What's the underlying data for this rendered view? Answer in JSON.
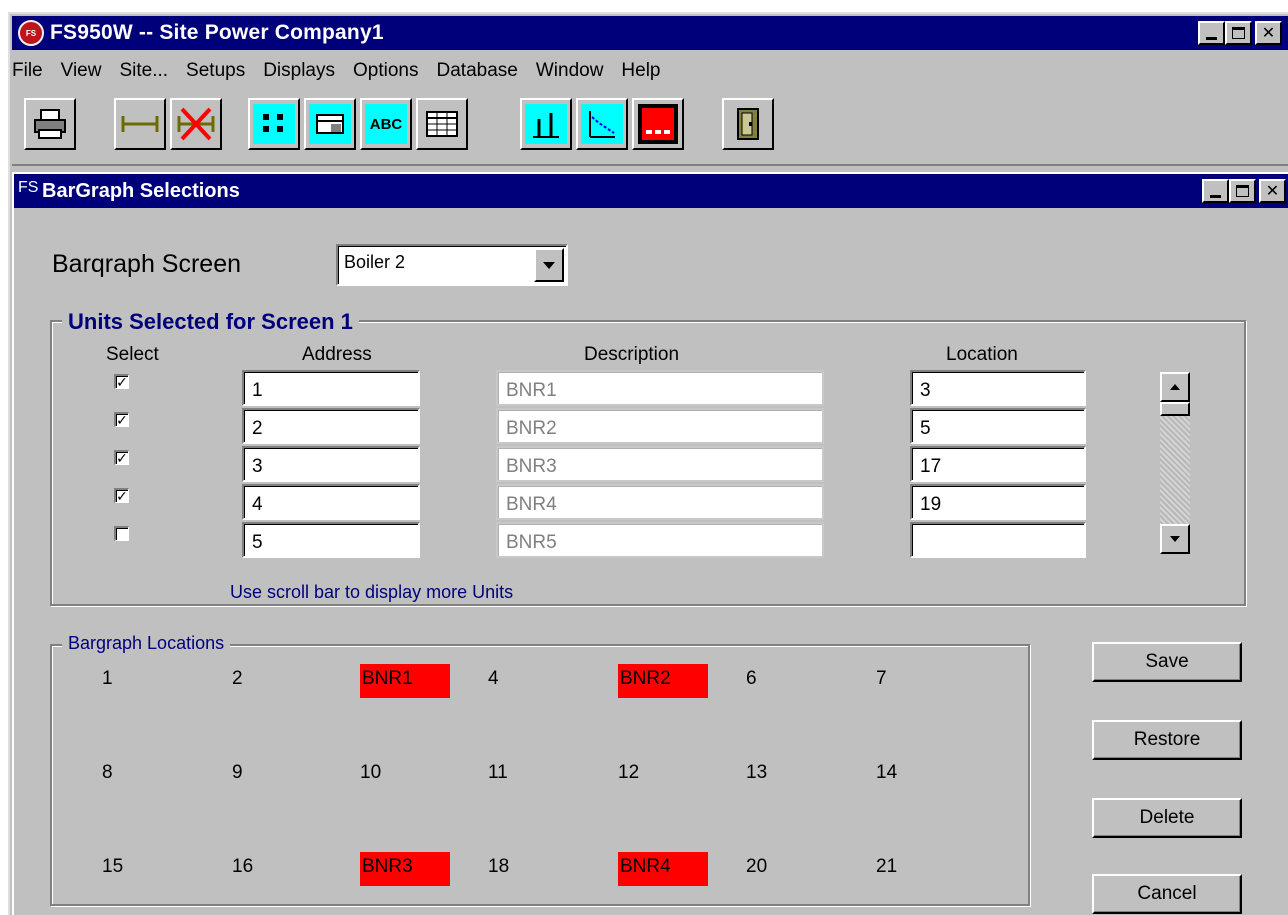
{
  "app": {
    "title": "FS950W -- Site Power Company1",
    "icon_name": "site-power-logo-icon"
  },
  "menu": [
    "File",
    "View",
    "Site...",
    "Setups",
    "Displays",
    "Options",
    "Database",
    "Window",
    "Help"
  ],
  "toolbar": {
    "buttons": [
      {
        "icon": "printer-icon"
      },
      {
        "icon": "range-connect-icon"
      },
      {
        "icon": "range-delete-icon"
      },
      {
        "icon": "list-view-icon"
      },
      {
        "icon": "detail-view-icon"
      },
      {
        "icon": "text-abc-icon",
        "text": "ABC"
      },
      {
        "icon": "table-view-icon"
      },
      {
        "icon": "bargraph-icon"
      },
      {
        "icon": "trend-chart-icon"
      },
      {
        "icon": "alarm-panel-icon"
      },
      {
        "icon": "door-exit-icon"
      }
    ]
  },
  "child_window": {
    "title": "BarGraph Selections",
    "bargraph_screen_label": "Barqraph Screen",
    "bargraph_screen_value": "Boiler 2",
    "units_group_title": "Units Selected for Screen 1",
    "columns": {
      "select": "Select",
      "address": "Address",
      "description": "Description",
      "location": "Location"
    },
    "units": [
      {
        "checked": true,
        "address": "1",
        "description": "BNR1",
        "location": "3"
      },
      {
        "checked": true,
        "address": "2",
        "description": "BNR2",
        "location": "5"
      },
      {
        "checked": true,
        "address": "3",
        "description": "BNR3",
        "location": "17"
      },
      {
        "checked": true,
        "address": "4",
        "description": "BNR4",
        "location": "19"
      },
      {
        "checked": false,
        "address": "5",
        "description": "BNR5",
        "location": ""
      }
    ],
    "scroll_hint": "Use scroll bar to display more Units",
    "locations_group_title": "Bargraph Locations",
    "locations": [
      [
        "1",
        "2",
        "BNR1",
        "4",
        "BNR2",
        "6",
        "7"
      ],
      [
        "8",
        "9",
        "10",
        "11",
        "12",
        "13",
        "14"
      ],
      [
        "15",
        "16",
        "BNR3",
        "18",
        "BNR4",
        "20",
        "21"
      ]
    ],
    "highlight_color": "#ff0000",
    "buttons": {
      "save": "Save",
      "restore": "Restore",
      "delete": "Delete",
      "cancel": "Cancel"
    }
  },
  "colors": {
    "title_bar": "#00007b",
    "window_bg": "#c0c0c0",
    "toolbar_cyan": "#00ffff"
  }
}
